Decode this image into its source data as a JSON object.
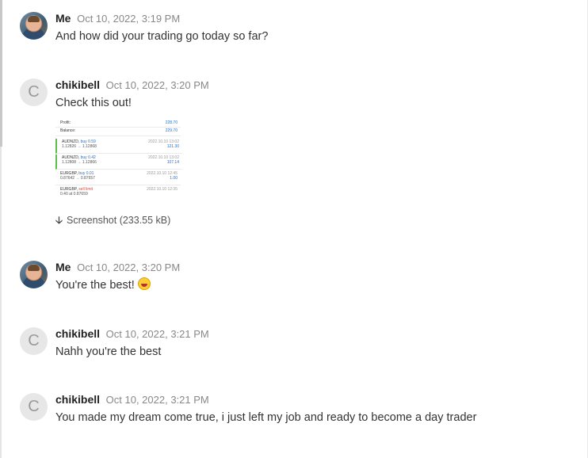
{
  "messages": [
    {
      "sender": "Me",
      "time": "Oct 10, 2022, 3:19 PM",
      "text": "And how did your trading go today so far?"
    },
    {
      "sender": "chikibell",
      "avatar_letter": "C",
      "time": "Oct 10, 2022, 3:20 PM",
      "text": "Check this out!",
      "attachment": {
        "summary": [
          {
            "label": "Profit:",
            "value": "228.70"
          },
          {
            "label": "Balance:",
            "value": "229.70"
          }
        ],
        "trades": [
          {
            "symbol": "AUDNZD,",
            "side": "buy 0.59",
            "prices": "1.12826 → 1.12868",
            "date": "2022.10.10 13:02",
            "profit": "121.30"
          },
          {
            "symbol": "AUDNZD,",
            "side": "buy 0.42",
            "prices": "1.12808 → 1.12866",
            "date": "2022.10.10 13:02",
            "profit": "107.14"
          },
          {
            "symbol": "EURGBP,",
            "side": "buy 0.01",
            "prices": "0.87642 → 0.87657",
            "date": "2022.10.10 12:45",
            "profit": "1.00"
          },
          {
            "symbol": "EURGBP,",
            "side": "sell limit",
            "prices": "0.40 at 0.87659",
            "date": "2022.10.10 12:35",
            "profit": ""
          }
        ],
        "download_label": "Screenshot (233.55 kB)"
      }
    },
    {
      "sender": "Me",
      "time": "Oct 10, 2022, 3:20 PM",
      "text": "You're the best!"
    },
    {
      "sender": "chikibell",
      "avatar_letter": "C",
      "time": "Oct 10, 2022, 3:21 PM",
      "text": "Nahh you're the best"
    },
    {
      "sender": "chikibell",
      "avatar_letter": "C",
      "time": "Oct 10, 2022, 3:21 PM",
      "text": "You made my dream come true, i just left my job and ready to become a day trader"
    }
  ],
  "colors": {
    "accent_blue": "#1f6fd1",
    "green": "#5bbd4a",
    "red": "#d24a3e",
    "avatar_gray": "#e7e7e7"
  }
}
